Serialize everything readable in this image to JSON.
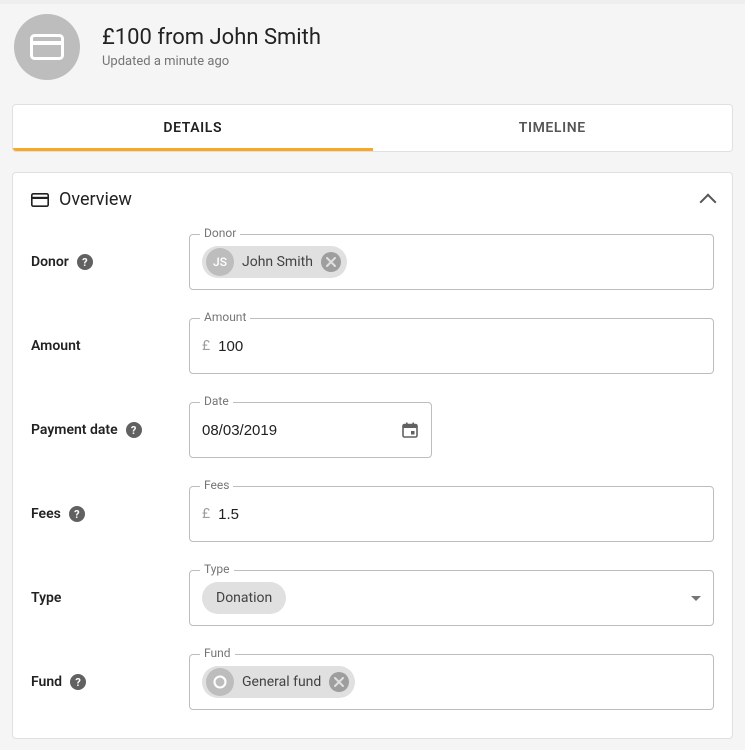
{
  "header": {
    "title": "£100 from John Smith",
    "subtitle": "Updated a minute ago"
  },
  "tabs": {
    "details": "DETAILS",
    "timeline": "TIMELINE"
  },
  "overview": {
    "title": "Overview"
  },
  "labels": {
    "donor": "Donor",
    "amount": "Amount",
    "payment_date": "Payment date",
    "fees": "Fees",
    "type": "Type",
    "fund": "Fund"
  },
  "field_labels": {
    "donor": "Donor",
    "amount": "Amount",
    "date": "Date",
    "fees": "Fees",
    "type": "Type",
    "fund": "Fund"
  },
  "values": {
    "donor_initials": "JS",
    "donor_name": "John Smith",
    "amount": "100",
    "date": "08/03/2019",
    "fees": "1.5",
    "type": "Donation",
    "fund": "General fund"
  },
  "currency": "£"
}
